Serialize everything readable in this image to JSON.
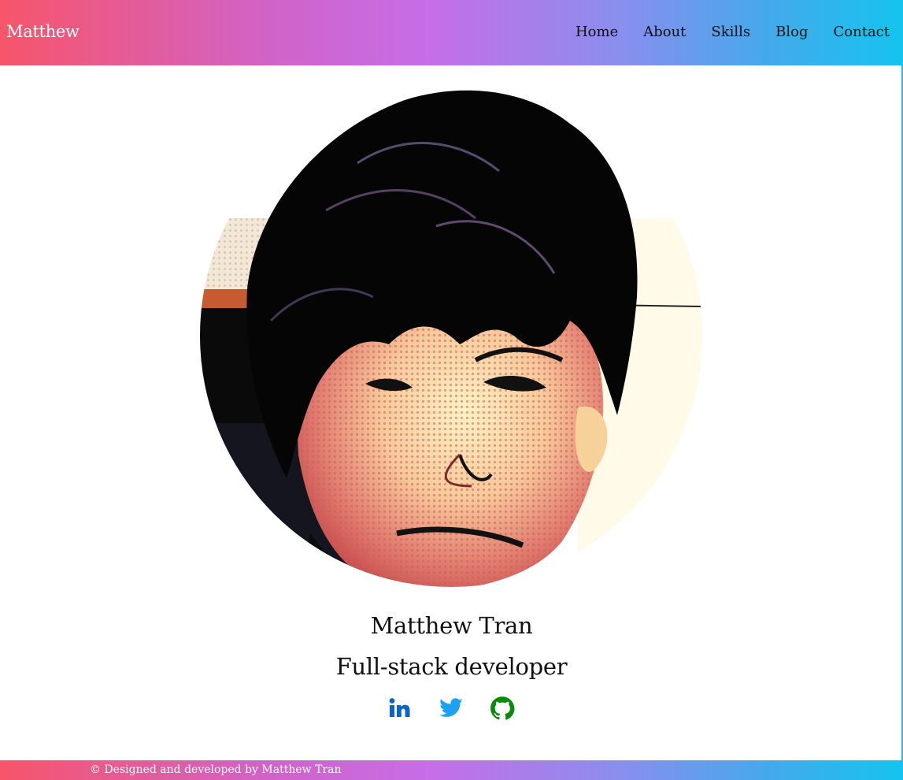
{
  "navbar": {
    "brand": "Matthew",
    "links": [
      "Home",
      "About",
      "Skills",
      "Blog",
      "Contact"
    ]
  },
  "profile": {
    "name": "Matthew Tran",
    "role": "Full-stack developer",
    "socials": [
      {
        "icon": "linkedin-icon",
        "color": "#0a66c2"
      },
      {
        "icon": "twitter-icon",
        "color": "#1da1f2"
      },
      {
        "icon": "github-icon",
        "color": "#0a8a0a"
      }
    ]
  },
  "footer": {
    "text": "© Designed and developed by Matthew Tran"
  },
  "colors": {
    "gradient_start": "#f7556a",
    "gradient_mid": "#c56ee8",
    "gradient_end": "#15c3ee"
  }
}
